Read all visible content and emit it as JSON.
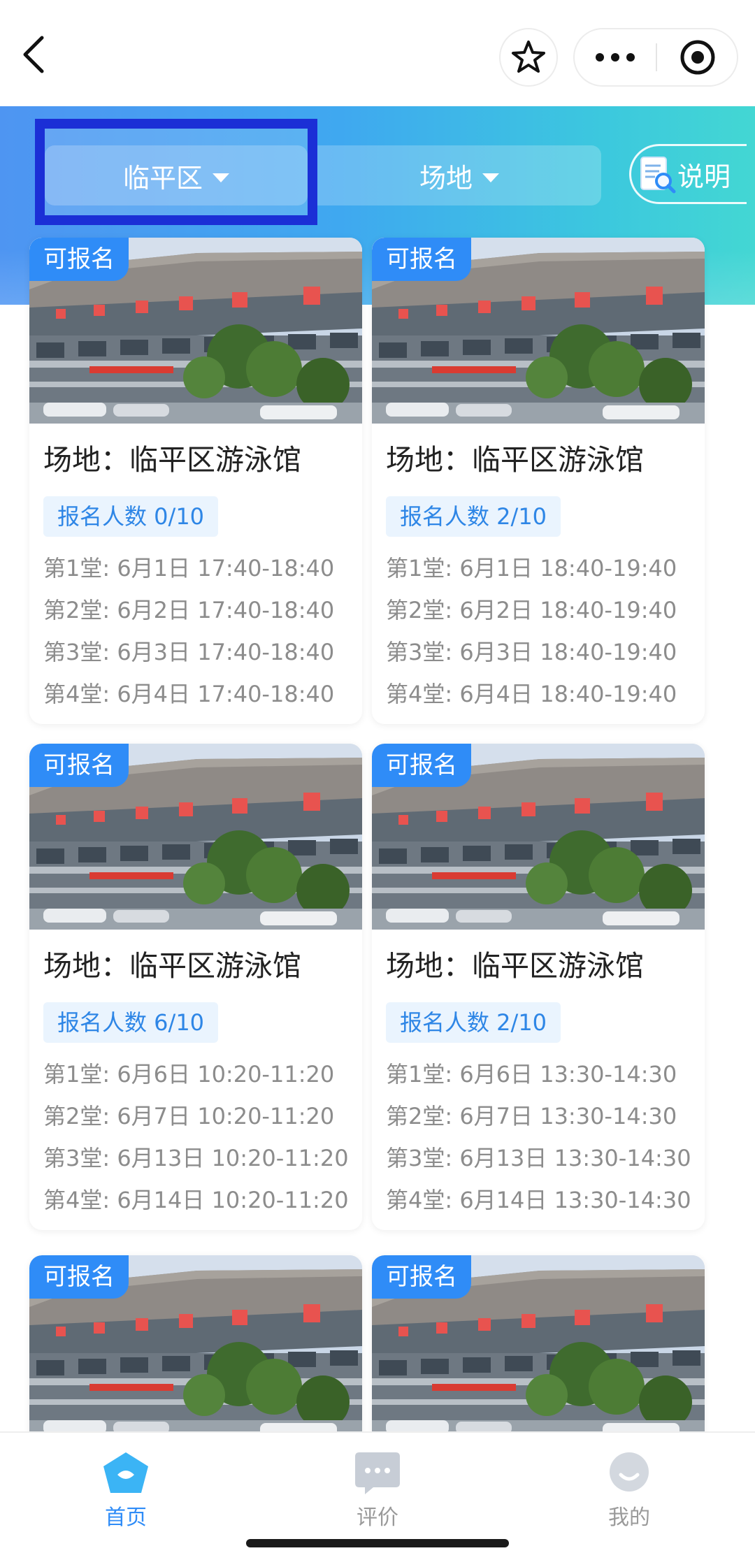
{
  "header": {
    "district_label": "临平区",
    "venue_label": "场地",
    "explain_label": "说明"
  },
  "cards": [
    {
      "badge": "可报名",
      "title": "场地：临平区游泳馆",
      "count": "报名人数 0/10",
      "sessions": [
        "第1堂: 6月1日 17:40-18:40",
        "第2堂: 6月2日 17:40-18:40",
        "第3堂: 6月3日 17:40-18:40",
        "第4堂: 6月4日 17:40-18:40"
      ]
    },
    {
      "badge": "可报名",
      "title": "场地：临平区游泳馆",
      "count": "报名人数 2/10",
      "sessions": [
        "第1堂: 6月1日 18:40-19:40",
        "第2堂: 6月2日 18:40-19:40",
        "第3堂: 6月3日 18:40-19:40",
        "第4堂: 6月4日 18:40-19:40"
      ]
    },
    {
      "badge": "可报名",
      "title": "场地：临平区游泳馆",
      "count": "报名人数 6/10",
      "sessions": [
        "第1堂: 6月6日 10:20-11:20",
        "第2堂: 6月7日 10:20-11:20",
        "第3堂: 6月13日 10:20-11:20",
        "第4堂: 6月14日 10:20-11:20"
      ]
    },
    {
      "badge": "可报名",
      "title": "场地：临平区游泳馆",
      "count": "报名人数 2/10",
      "sessions": [
        "第1堂: 6月6日 13:30-14:30",
        "第2堂: 6月7日 13:30-14:30",
        "第3堂: 6月13日 13:30-14:30",
        "第4堂: 6月14日 13:30-14:30"
      ]
    },
    {
      "badge": "可报名"
    },
    {
      "badge": "可报名"
    }
  ],
  "tabs": [
    {
      "label": "首页",
      "icon": "home-icon",
      "active": true
    },
    {
      "label": "评价",
      "icon": "chat-icon",
      "active": false
    },
    {
      "label": "我的",
      "icon": "user-icon",
      "active": false
    }
  ],
  "colors": {
    "accent": "#2f8cf7",
    "highlight_border": "#1b2fd6",
    "pill_bg": "#eaf4fe"
  }
}
